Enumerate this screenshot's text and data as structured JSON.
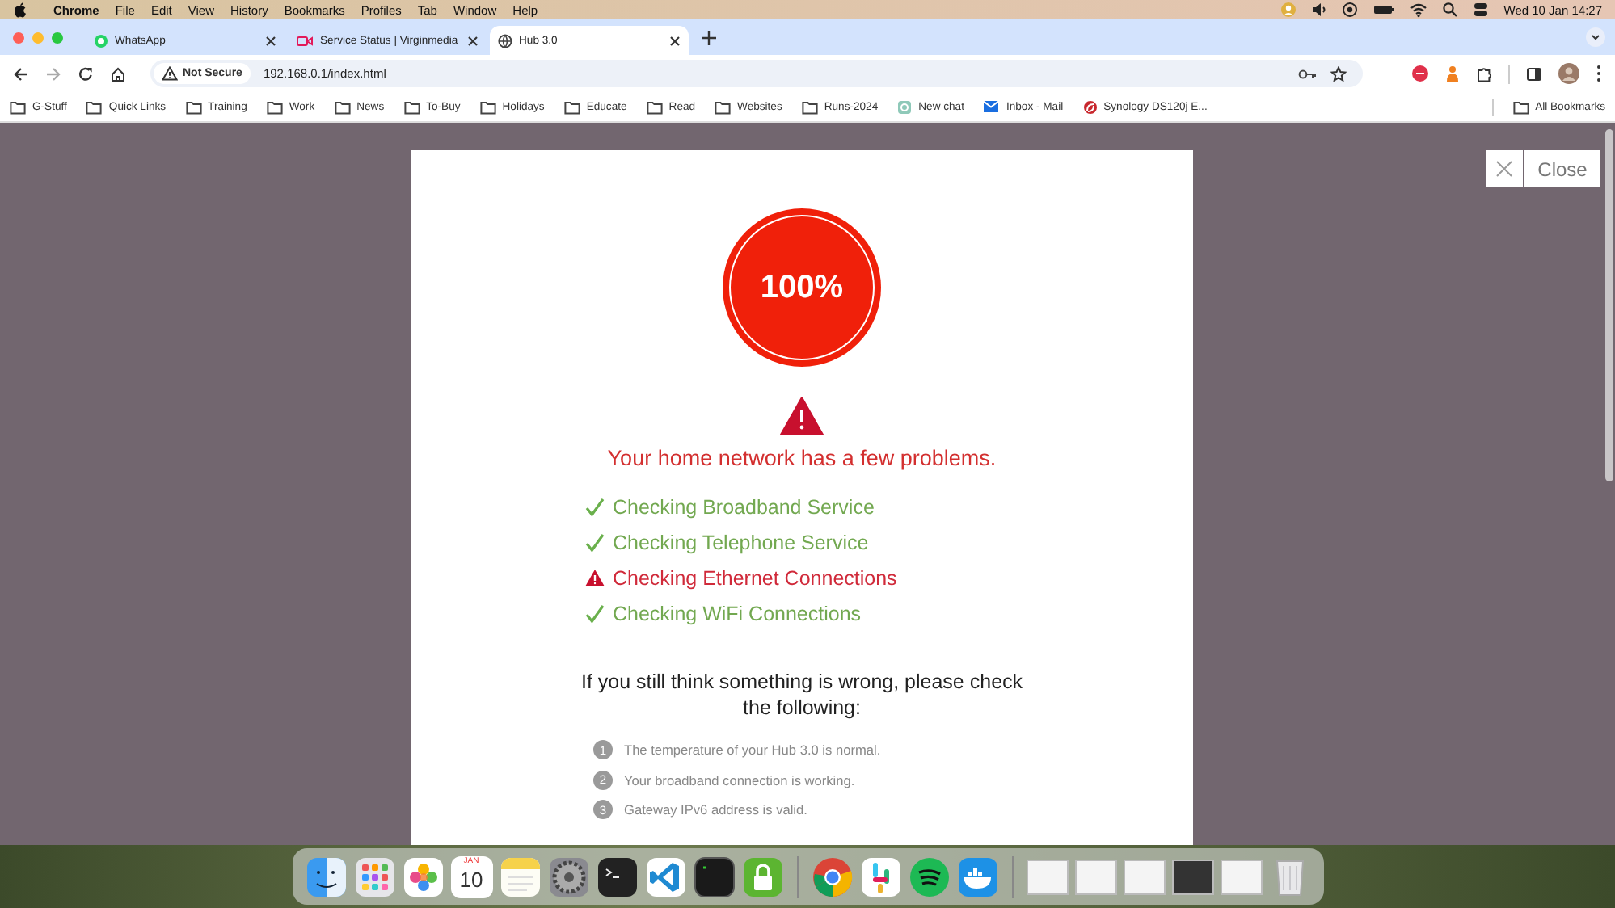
{
  "menu_bar": {
    "app": "Chrome",
    "items": [
      "File",
      "Edit",
      "View",
      "History",
      "Bookmarks",
      "Profiles",
      "Tab",
      "Window",
      "Help"
    ],
    "clock": "Wed 10 Jan 14:27"
  },
  "tabs": [
    {
      "title": "WhatsApp",
      "kind": "whatsapp",
      "selected": false
    },
    {
      "title": "Service Status | Virginmedia",
      "kind": "video",
      "selected": false
    },
    {
      "title": "Hub 3.0",
      "kind": "globe",
      "selected": true
    }
  ],
  "address_bar": {
    "security": "Not Secure",
    "url": "192.168.0.1/index.html"
  },
  "bookmarks": [
    {
      "label": "G-Stuff",
      "kind": "folder"
    },
    {
      "label": "Quick Links",
      "kind": "folder"
    },
    {
      "label": "Training",
      "kind": "folder"
    },
    {
      "label": "Work",
      "kind": "folder"
    },
    {
      "label": "News",
      "kind": "folder"
    },
    {
      "label": "To-Buy",
      "kind": "folder"
    },
    {
      "label": "Holidays",
      "kind": "folder"
    },
    {
      "label": "Educate",
      "kind": "folder"
    },
    {
      "label": "Read",
      "kind": "folder"
    },
    {
      "label": "Websites",
      "kind": "folder"
    },
    {
      "label": "Runs-2024",
      "kind": "folder"
    },
    {
      "label": "New chat",
      "kind": "chat"
    },
    {
      "label": "Inbox - Mail",
      "kind": "mail"
    },
    {
      "label": "Synology DS120j E...",
      "kind": "site"
    }
  ],
  "all_bookmarks": "All Bookmarks",
  "dialog": {
    "close_label": "Close",
    "score": "100%",
    "headline": "Your home network has a few problems.",
    "checks": [
      {
        "label": "Checking Broadband Service",
        "kind": "passed"
      },
      {
        "label": "Checking Telephone Service",
        "kind": "passed"
      },
      {
        "label": "Checking Ethernet Connections",
        "kind": "warning"
      },
      {
        "label": "Checking WiFi Connections",
        "kind": "passed"
      }
    ],
    "advice": "If you still think something is wrong, please check the following:",
    "items": [
      {
        "number": "1",
        "text": "The temperature of your Hub 3.0 is normal."
      },
      {
        "number": "2",
        "text": "Your broadband connection is working."
      },
      {
        "number": "3",
        "text": "Gateway IPv6 address is valid."
      }
    ]
  },
  "dock": {
    "calendar_month": "JAN",
    "calendar_day": "10"
  }
}
